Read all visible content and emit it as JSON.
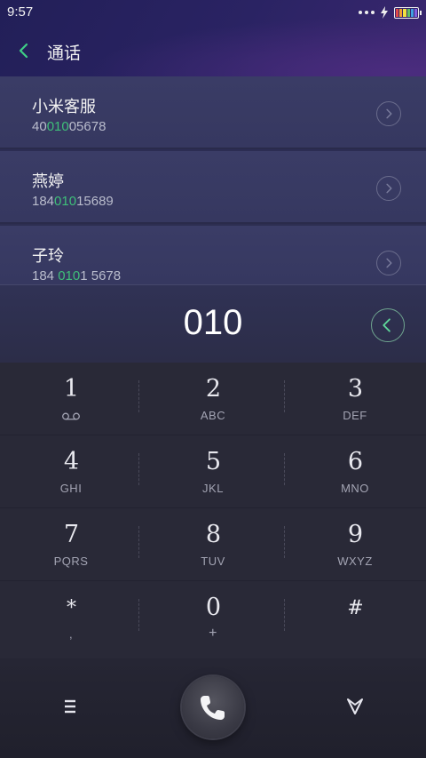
{
  "status": {
    "time": "9:57"
  },
  "header": {
    "title": "通话"
  },
  "contacts": [
    {
      "name": "小米客服",
      "number_pre": "40",
      "number_match": "010",
      "number_post": "05678"
    },
    {
      "name": "燕婷",
      "number_pre": "184",
      "number_match": "010",
      "number_post": "15689"
    },
    {
      "name": "子玲",
      "number_pre": "184 ",
      "number_match": "010",
      "number_post": "1 5678"
    }
  ],
  "dialer": {
    "number": "010"
  },
  "keypad": {
    "keys": [
      {
        "digit": "1",
        "letters": ""
      },
      {
        "digit": "2",
        "letters": "ABC"
      },
      {
        "digit": "3",
        "letters": "DEF"
      },
      {
        "digit": "4",
        "letters": "GHI"
      },
      {
        "digit": "5",
        "letters": "JKL"
      },
      {
        "digit": "6",
        "letters": "MNO"
      },
      {
        "digit": "7",
        "letters": "PQRS"
      },
      {
        "digit": "8",
        "letters": "TUV"
      },
      {
        "digit": "9",
        "letters": "WXYZ"
      },
      {
        "digit": "*",
        "letters": ","
      },
      {
        "digit": "0",
        "letters": "+"
      },
      {
        "digit": "#",
        "letters": ""
      }
    ]
  },
  "colors": {
    "accent_green": "#3fbf79",
    "battery_colors": [
      "#e04848",
      "#f0a030",
      "#f0e040",
      "#60c060",
      "#40a0e0",
      "#8060e0"
    ]
  },
  "icons": {
    "back": "chevron-left-icon",
    "detail": "chevron-right-circle-icon",
    "delete": "backspace-icon",
    "voicemail": "voicemail-icon",
    "menu": "menu-icon",
    "call": "phone-icon",
    "collapse": "collapse-keypad-icon"
  }
}
